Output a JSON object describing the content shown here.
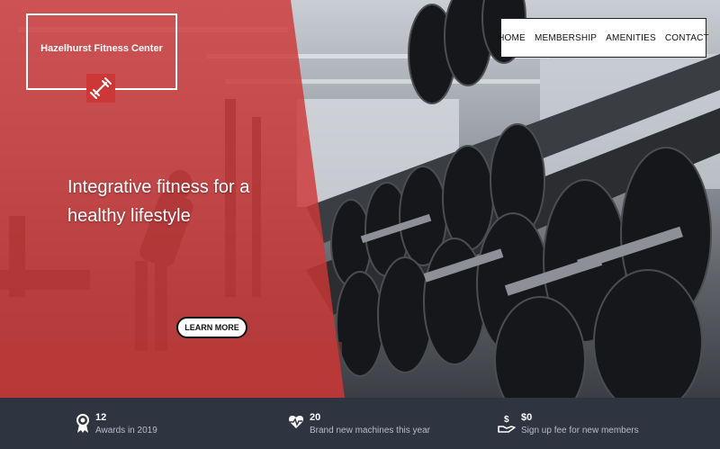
{
  "brand": {
    "name": "Hazelhurst Fitness Center",
    "logo_icon": "dumbbell-icon"
  },
  "nav": {
    "items": [
      {
        "label": "HOME"
      },
      {
        "label": "MEMBERSHIP"
      },
      {
        "label": "AMENITIES"
      },
      {
        "label": "CONTACT"
      }
    ]
  },
  "hero": {
    "headline": "Integrative fitness for a healthy lifestyle",
    "cta_label": "LEARN MORE",
    "overlay_color": "#cd3737"
  },
  "stats": [
    {
      "icon": "award-ribbon-icon",
      "value": "12",
      "label": "Awards in 2019"
    },
    {
      "icon": "heart-pulse-icon",
      "value": "20",
      "label": "Brand new machines this year"
    },
    {
      "icon": "hand-dollar-icon",
      "value": "$0",
      "label": "Sign up fee for new members"
    }
  ]
}
